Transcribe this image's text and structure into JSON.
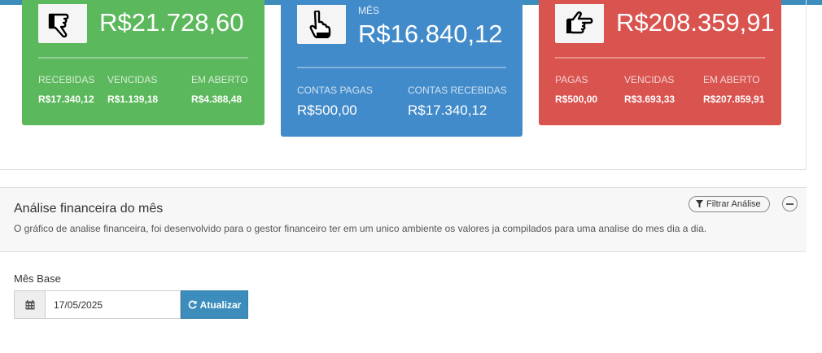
{
  "cards": {
    "green": {
      "icon": "thumbs-down-hand-icon",
      "total": "R$21.728,60",
      "stats": [
        {
          "label": "RECEBIDAS",
          "value": "R$17.340,12"
        },
        {
          "label": "VENCIDAS",
          "value": "R$1.139,18"
        },
        {
          "label": "EM ABERTO",
          "value": "R$4.388,48"
        }
      ],
      "color": "#5cb85c"
    },
    "blue": {
      "icon": "pointing-up-hand-icon",
      "title": "MÊS",
      "total": "R$16.840,12",
      "stats": [
        {
          "label": "CONTAS PAGAS",
          "value": "R$500,00"
        },
        {
          "label": "CONTAS RECEBIDAS",
          "value": "R$17.340,12"
        }
      ],
      "color": "#428bca"
    },
    "red": {
      "icon": "pointing-right-hand-icon",
      "total": "R$208.359,91",
      "stats": [
        {
          "label": "PAGAS",
          "value": "R$500,00"
        },
        {
          "label": "VENCIDAS",
          "value": "R$3.693,33"
        },
        {
          "label": "EM ABERTO",
          "value": "R$207.859,91"
        }
      ],
      "color": "#d9534f"
    }
  },
  "panel": {
    "title": "Análise financeira do mês",
    "description": "O gráfico de analise financeira, foi desenvolvido para o gestor financeiro ter em um unico ambiente os valores ja compilados para uma analise do mes dia a dia.",
    "filter_label": "Filtrar Análise",
    "field_label": "Mês Base",
    "date_value": "17/05/2025",
    "update_label": "Atualizar"
  }
}
